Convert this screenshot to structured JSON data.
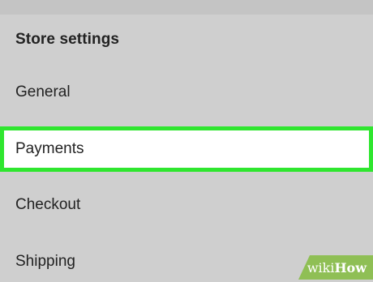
{
  "section": {
    "title": "Store settings"
  },
  "menu": {
    "items": [
      {
        "label": "General"
      },
      {
        "label": "Payments",
        "highlighted": true
      },
      {
        "label": "Checkout"
      },
      {
        "label": "Shipping"
      }
    ]
  },
  "watermark": {
    "prefix": "wiki",
    "suffix": "How"
  },
  "colors": {
    "background": "#cfcfcf",
    "highlight_border": "#2fe62f",
    "selected_background": "#ffffff",
    "text": "#222222"
  }
}
